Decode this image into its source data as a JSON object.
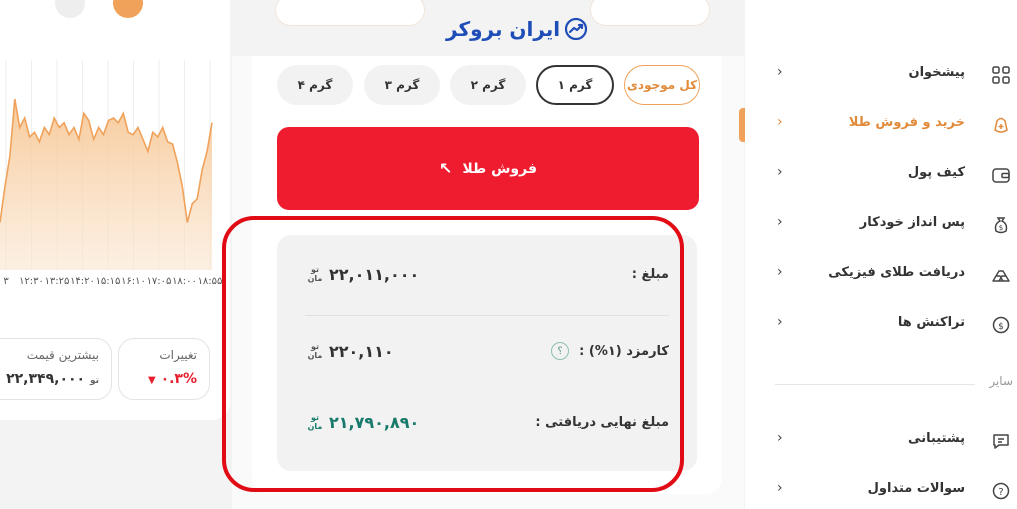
{
  "brand": {
    "name": "ایران بروکر",
    "color": "#1f4db8"
  },
  "colors": {
    "accent": "#f0a25a",
    "sell": "#ef1c2f",
    "received": "#177a6a",
    "negative": "#e8202e"
  },
  "chart_data": {
    "type": "area",
    "x": [
      "۱۲:۳۰",
      "۱۳:۲۵",
      "۱۴:۲۰",
      "۱۵:۱۵",
      "۱۶:۱۰",
      "۱۷:۰۵",
      "۱۸:۰۰",
      "۱۸:۵۵"
    ],
    "x_tick_prefix": "۳",
    "series": [
      {
        "values": [
          20,
          35,
          48,
          72,
          60,
          64,
          56,
          58,
          54,
          60,
          57,
          64,
          60,
          62,
          57,
          60,
          55,
          66,
          63,
          55,
          60,
          57,
          63,
          64,
          62,
          66,
          58,
          57,
          60,
          55,
          50,
          58,
          56,
          60,
          54,
          53,
          45,
          35,
          20,
          28,
          30,
          42,
          50,
          62
        ]
      }
    ],
    "color": "#f0a25a",
    "grid": "vertical"
  },
  "stats": {
    "change": {
      "label": "تغییرات",
      "value": "۰.۳%",
      "direction": "down"
    },
    "max": {
      "label": "بیشترین قیمت",
      "value": "۲۲,۳۴۹,۰۰۰",
      "unit_label": "تو"
    }
  },
  "gram_options": {
    "all": "کل موجودی",
    "g1": "۱ گرم",
    "g2": "۲ گرم",
    "g3": "۳ گرم",
    "g4": "۴ گرم",
    "selected": "۱ گرم"
  },
  "sell_button": {
    "label": "فروش طلا",
    "icon": "arrow-up-left-icon"
  },
  "summary": {
    "amount": {
      "label": "مبلغ :",
      "value": "۲۲,۰۱۱,۰۰۰"
    },
    "fee": {
      "label": "کارمزد (۱%) :",
      "value": "۲۲۰,۱۱۰",
      "help": "؟"
    },
    "received": {
      "label": "مبلغ نهایی دریافتی :",
      "value": "۲۱,۷۹۰,۸۹۰"
    },
    "unit_line1": "تو",
    "unit_line2": "مان"
  },
  "sidebar": {
    "items": [
      {
        "label": "پیشخوان",
        "icon": "dashboard-grid-icon"
      },
      {
        "label": "خرید و فروش طلا",
        "icon": "gold-trade-icon",
        "active": true
      },
      {
        "label": "کیف پول",
        "icon": "wallet-icon"
      },
      {
        "label": "پس انداز خودکار",
        "icon": "money-bag-icon"
      },
      {
        "label": "دریافت طلای فیزیکی",
        "icon": "gold-bars-icon"
      },
      {
        "label": "تراکنش ها",
        "icon": "transactions-icon"
      }
    ],
    "other_title": "سایر",
    "other_items": [
      {
        "label": "پشتیبانی",
        "icon": "chat-support-icon"
      },
      {
        "label": "سوالات متداول",
        "icon": "question-circle-icon"
      }
    ]
  }
}
